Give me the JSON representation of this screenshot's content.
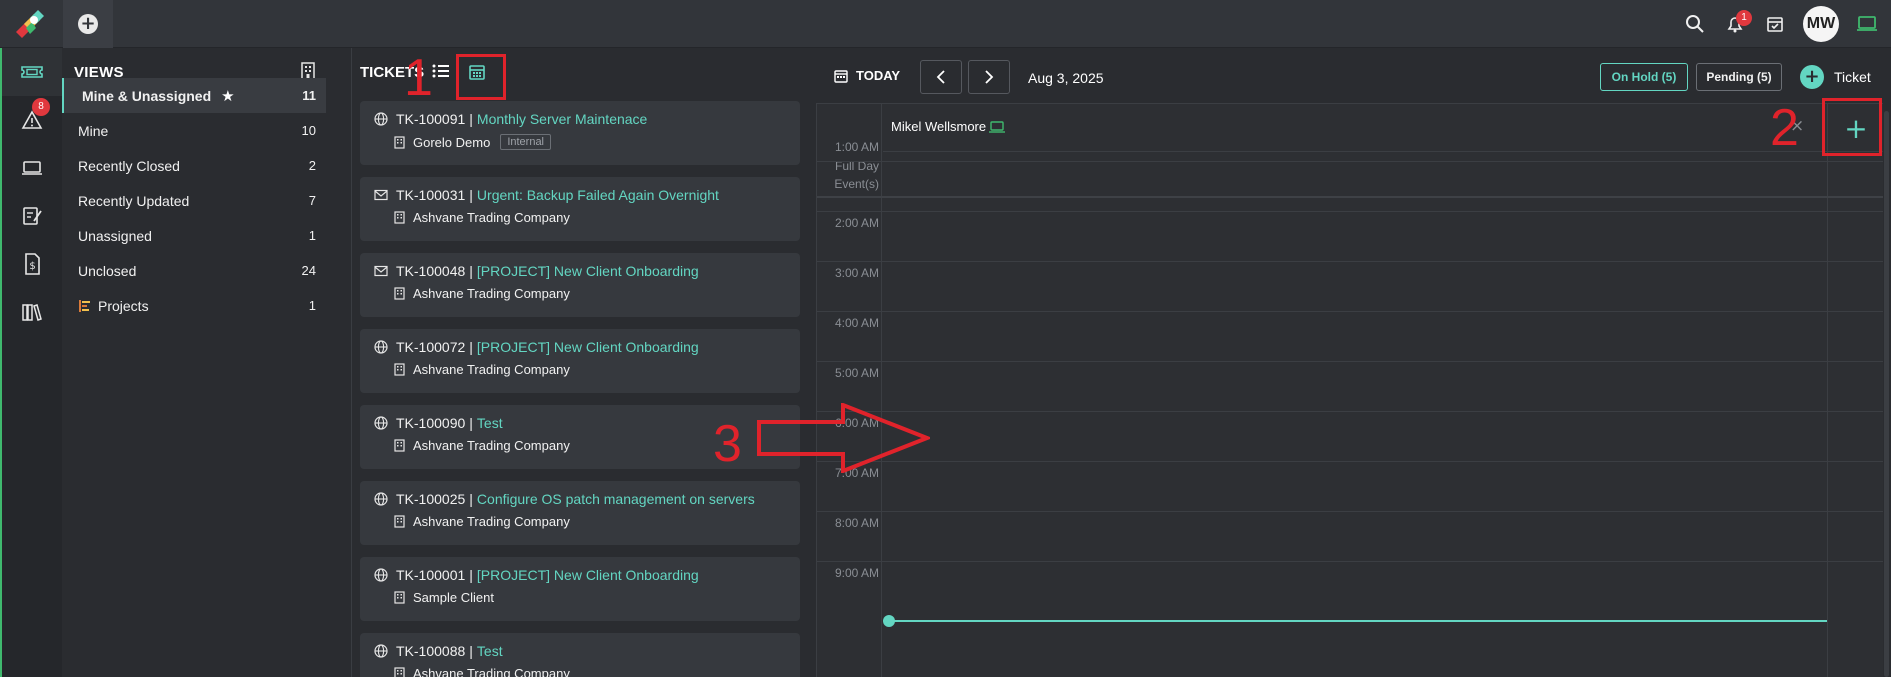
{
  "topbar": {
    "logo_icon": "app-logo-icon",
    "new_tab_icon": "plus-circle-icon",
    "notification_count": "1",
    "avatar_initials": "MW"
  },
  "rail": {
    "items": [
      {
        "icon": "ticket-icon",
        "active": true
      },
      {
        "icon": "alert-icon",
        "badge": "8"
      },
      {
        "icon": "laptop-icon"
      },
      {
        "icon": "contract-icon"
      },
      {
        "icon": "billing-icon"
      },
      {
        "icon": "library-icon"
      }
    ]
  },
  "views": {
    "title": "VIEWS",
    "items": [
      {
        "label": "Mine & Unassigned",
        "count": "11",
        "active": true
      },
      {
        "label": "Mine",
        "count": "10"
      },
      {
        "label": "Recently Closed",
        "count": "2"
      },
      {
        "label": "Recently Updated",
        "count": "7"
      },
      {
        "label": "Unassigned",
        "count": "1"
      },
      {
        "label": "Unclosed",
        "count": "24"
      },
      {
        "label": "Projects",
        "count": "1"
      }
    ]
  },
  "tickets": {
    "title": "TICKETS",
    "items": [
      {
        "id": "TK-100091",
        "subject": "Monthly Server Maintenace",
        "org": "Gorelo Demo",
        "tag": "Internal",
        "source": "globe"
      },
      {
        "id": "TK-100031",
        "subject": "Urgent: Backup Failed Again Overnight",
        "org": "Ashvane Trading Company",
        "source": "mail"
      },
      {
        "id": "TK-100048",
        "subject": "[PROJECT] New Client Onboarding",
        "org": "Ashvane Trading Company",
        "source": "mail"
      },
      {
        "id": "TK-100072",
        "subject": "[PROJECT] New Client Onboarding",
        "org": "Ashvane Trading Company",
        "source": "globe"
      },
      {
        "id": "TK-100090",
        "subject": "Test",
        "org": "Ashvane Trading Company",
        "source": "globe"
      },
      {
        "id": "TK-100025",
        "subject": "Configure OS patch management on servers",
        "org": "Ashvane Trading Company",
        "source": "globe"
      },
      {
        "id": "TK-100001",
        "subject": "[PROJECT] New Client Onboarding",
        "org": "Sample Client",
        "source": "globe"
      },
      {
        "id": "TK-100088",
        "subject": "Test",
        "org": "Ashvane Trading Company",
        "source": "globe"
      }
    ]
  },
  "calendar": {
    "today_label": "TODAY",
    "date": "Aug 3, 2025",
    "on_hold": "On Hold (5)",
    "pending": "Pending (5)",
    "add_ticket": "Ticket",
    "resource": "Mikel Wellsmore",
    "full_day_line1": "Full Day",
    "full_day_line2": "Event(s)",
    "hours": [
      "1:00 AM",
      "2:00 AM",
      "3:00 AM",
      "4:00 AM",
      "5:00 AM",
      "6:00 AM",
      "7:00 AM",
      "8:00 AM",
      "9:00 AM"
    ],
    "add_column": "+",
    "close": "×"
  },
  "annotations": {
    "one": "1",
    "two": "2",
    "three": "3"
  },
  "colors": {
    "accent": "#63d6c2",
    "annotation": "#e0232b",
    "badge": "#e0383e"
  }
}
